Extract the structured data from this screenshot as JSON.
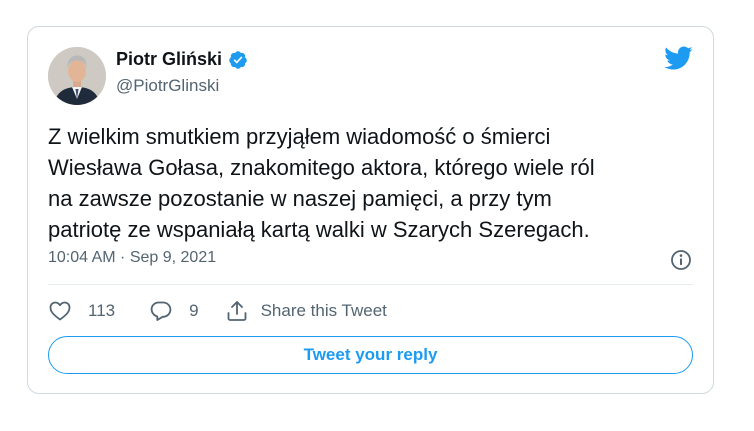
{
  "author": {
    "display_name": "Piotr Gliński",
    "handle": "@PiotrGlinski",
    "verified": true
  },
  "tweet": {
    "text_lines": [
      "Z wielkim smutkiem przyjąłem wiadomość o śmierci",
      "Wiesława Gołasa, znakomitego aktora, którego wiele ról",
      "na zawsze pozostanie w naszej pamięci, a przy tym",
      "patriotę ze wspaniałą kartą walki w Szarych Szeregach."
    ],
    "timestamp": "10:04 AM · Sep 9, 2021"
  },
  "actions": {
    "likes": "113",
    "replies": "9",
    "share_label": "Share this Tweet"
  },
  "reply_button_label": "Tweet your reply",
  "icons": {
    "brand": "twitter-bird-icon",
    "verified": "verified-badge-icon",
    "info": "info-icon",
    "like": "heart-icon",
    "reply": "reply-bubble-icon",
    "share": "share-icon"
  },
  "colors": {
    "accent": "#1d9bf0",
    "text": "#0f1419",
    "muted": "#536471",
    "border": "#cfd9de"
  }
}
